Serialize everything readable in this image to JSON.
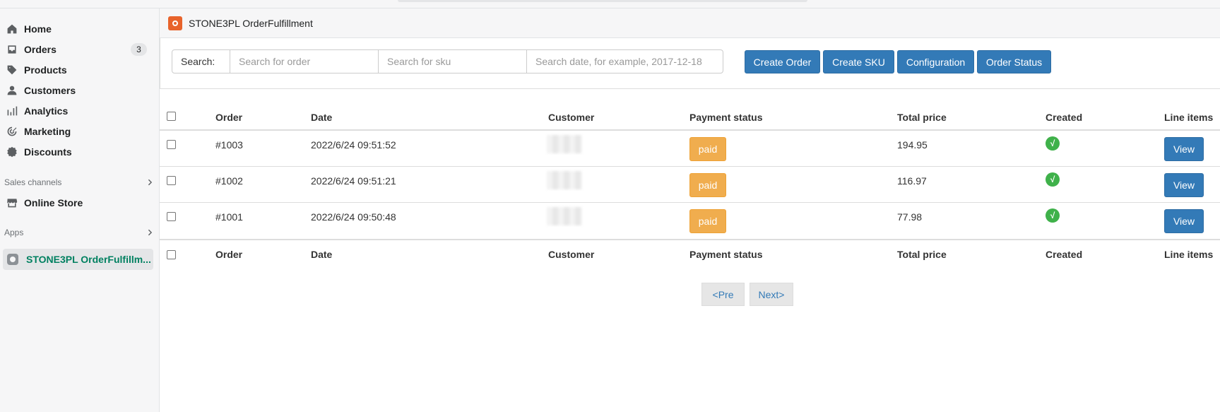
{
  "sidebar": {
    "items": [
      {
        "label": "Home",
        "icon": "home-icon"
      },
      {
        "label": "Orders",
        "icon": "inbox-icon",
        "badge": "3"
      },
      {
        "label": "Products",
        "icon": "tag-icon"
      },
      {
        "label": "Customers",
        "icon": "person-icon"
      },
      {
        "label": "Analytics",
        "icon": "bar-chart-icon"
      },
      {
        "label": "Marketing",
        "icon": "target-icon"
      },
      {
        "label": "Discounts",
        "icon": "discount-icon"
      }
    ],
    "sales_channels_label": "Sales channels",
    "online_store_label": "Online Store",
    "apps_label": "Apps",
    "active_app_label": "STONE3PL OrderFulfillm..."
  },
  "app_header": {
    "title": "STONE3PL OrderFulfillment",
    "logo_color": "#e8632b"
  },
  "toolbar": {
    "search_label": "Search:",
    "order_placeholder": "Search for order",
    "sku_placeholder": "Search for sku",
    "date_placeholder": "Search date, for example, 2017-12-18",
    "buttons": [
      "Create Order",
      "Create SKU",
      "Configuration",
      "Order Status"
    ]
  },
  "table": {
    "columns": [
      "Order",
      "Date",
      "Customer",
      "Payment status",
      "Total price",
      "Created",
      "Line items"
    ],
    "rows": [
      {
        "order": "#1003",
        "date": "2022/6/24 09:51:52",
        "payment": "paid",
        "total": "194.95",
        "created": "√",
        "action": "View"
      },
      {
        "order": "#1002",
        "date": "2022/6/24 09:51:21",
        "payment": "paid",
        "total": "116.97",
        "created": "√",
        "action": "View"
      },
      {
        "order": "#1001",
        "date": "2022/6/24 09:50:48",
        "payment": "paid",
        "total": "77.98",
        "created": "√",
        "action": "View"
      }
    ]
  },
  "pagination": {
    "prev_label": "<Pre",
    "next_label": "Next>"
  },
  "colors": {
    "primary_button": "#337ab7",
    "paid_badge": "#f0ad4e",
    "created_check": "#3fb14a",
    "active_app_text": "#008060"
  }
}
